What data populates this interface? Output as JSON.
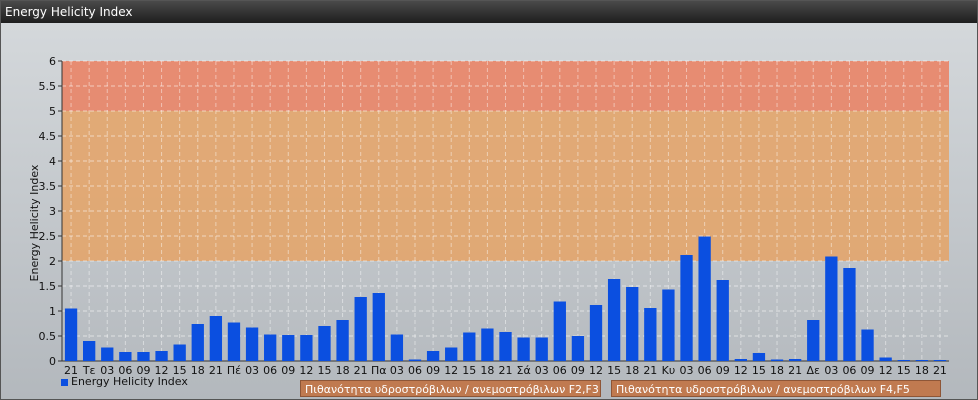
{
  "window": {
    "title": "Energy Helicity Index"
  },
  "risk_labels": [
    "Πιθανότητα υδροστρόβιλων / ανεμοστρόβιλων F2,F3",
    "Πιθανότητα υδροστρόβιλων / ανεμοστρόβιλων F4,F5"
  ],
  "colors": {
    "bar": "#0b4fe0",
    "band_low": "#e3a56b",
    "band_high": "#e98467",
    "title_bar": "#2a2a2a"
  },
  "chart_data": {
    "type": "bar",
    "title": "Energy Helicity Index",
    "ylabel": "Energy Helicity Index",
    "xlabel": "",
    "ylim": [
      0,
      6
    ],
    "yticks": [
      "0",
      "0.5",
      "1",
      "1.5",
      "2",
      "2.5",
      "3",
      "3.5",
      "4",
      "4.5",
      "5",
      "5.5",
      "6"
    ],
    "ytick_values": [
      0,
      0.5,
      1,
      1.5,
      2,
      2.5,
      3,
      3.5,
      4,
      4.5,
      5,
      5.5,
      6
    ],
    "grid": true,
    "legend_position": "bottom-left",
    "bands": [
      {
        "from": 2,
        "to": 5,
        "color": "#e3a56b"
      },
      {
        "from": 5,
        "to": 6,
        "color": "#e98467"
      }
    ],
    "categories": [
      "21",
      "Τε",
      "03",
      "06",
      "09",
      "12",
      "15",
      "18",
      "21",
      "Πέ",
      "03",
      "06",
      "09",
      "12",
      "15",
      "18",
      "21",
      "Πα",
      "03",
      "06",
      "09",
      "12",
      "15",
      "18",
      "21",
      "Σά",
      "03",
      "06",
      "09",
      "12",
      "15",
      "18",
      "21",
      "Κυ",
      "03",
      "06",
      "09",
      "12",
      "15",
      "18",
      "21",
      "Δε",
      "03",
      "06",
      "09",
      "12",
      "15",
      "18",
      "21"
    ],
    "series": [
      {
        "name": "Energy Helicity Index",
        "values": [
          1.05,
          0.4,
          0.27,
          0.18,
          0.18,
          0.2,
          0.33,
          0.74,
          0.9,
          0.77,
          0.67,
          0.53,
          0.52,
          0.52,
          0.7,
          0.82,
          1.28,
          1.36,
          0.53,
          0.03,
          0.2,
          0.27,
          0.57,
          0.65,
          0.58,
          0.47,
          0.47,
          1.19,
          0.5,
          1.12,
          1.64,
          1.48,
          1.06,
          1.43,
          2.12,
          2.49,
          1.62,
          0.04,
          0.16,
          0.03,
          0.04,
          0.82,
          2.09,
          1.86,
          0.63,
          0.07,
          0.02,
          0.02,
          0.02
        ]
      }
    ]
  }
}
